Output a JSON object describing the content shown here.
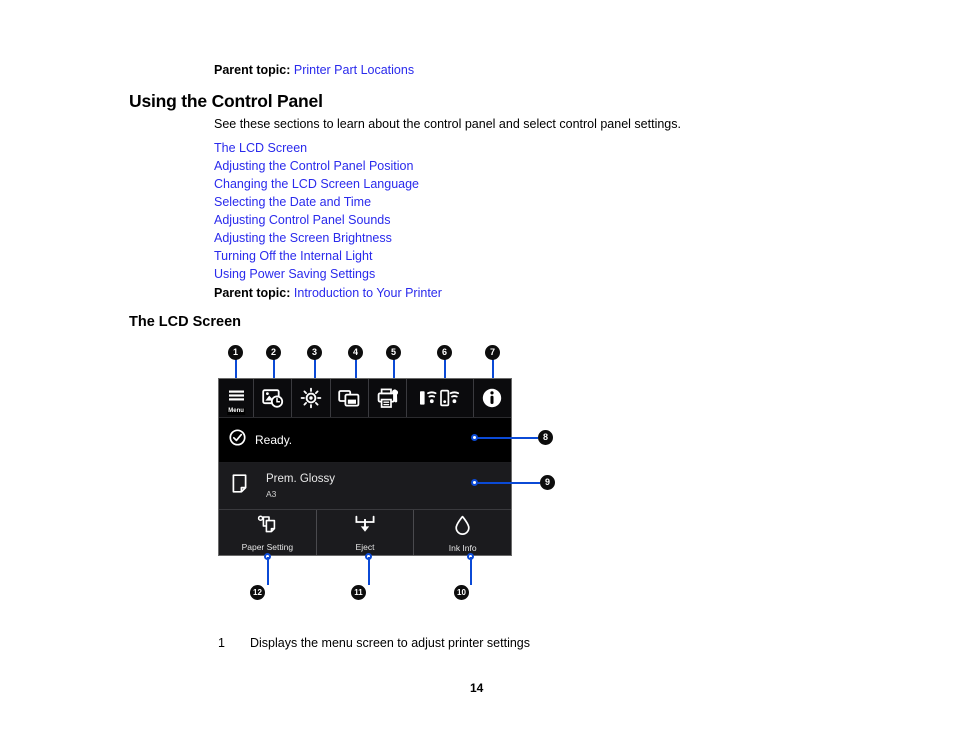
{
  "document": {
    "page_number": "14"
  },
  "top_parent_topic": {
    "label": "Parent topic:",
    "link": "Printer Part Locations"
  },
  "section": {
    "heading": "Using the Control Panel",
    "intro": "See these sections to learn about the control panel and select control panel settings.",
    "links": [
      "The LCD Screen",
      "Adjusting the Control Panel Position",
      "Changing the LCD Screen Language",
      "Selecting the Date and Time",
      "Adjusting Control Panel Sounds",
      "Adjusting the Screen Brightness",
      "Turning Off the Internal Light",
      "Using Power Saving Settings"
    ],
    "parent_topic": {
      "label": "Parent topic:",
      "link": "Introduction to Your Printer"
    }
  },
  "subsection": {
    "heading": "The LCD Screen"
  },
  "lcd": {
    "toolbar": [
      {
        "id": 1,
        "icon": "menu-icon",
        "label": "Menu"
      },
      {
        "id": 2,
        "icon": "print-history-icon",
        "label": ""
      },
      {
        "id": 3,
        "icon": "internal-light-icon",
        "label": ""
      },
      {
        "id": 4,
        "icon": "job-queue-icon",
        "label": ""
      },
      {
        "id": 5,
        "icon": "printer-maintenance-icon",
        "label": ""
      },
      {
        "id": 6,
        "icon": "network-status-icon",
        "label": ""
      },
      {
        "id": 7,
        "icon": "information-icon",
        "label": ""
      }
    ],
    "status": {
      "icon": "check-circle-icon",
      "text": "Ready."
    },
    "paper": {
      "icon": "paper-sheet-icon",
      "type": "Prem. Glossy",
      "size": "A3"
    },
    "buttons": [
      {
        "icon": "paper-setting-icon",
        "label": "Paper Setting"
      },
      {
        "icon": "eject-icon",
        "label": "Eject"
      },
      {
        "icon": "ink-drop-icon",
        "label": "Ink Info"
      }
    ],
    "callouts": [
      "1",
      "2",
      "3",
      "4",
      "5",
      "6",
      "7",
      "8",
      "9",
      "10",
      "11",
      "12"
    ]
  },
  "legend": {
    "items": [
      {
        "num": "1",
        "text": "Displays the menu screen to adjust printer settings"
      }
    ]
  },
  "colors": {
    "link": "#2a2aec",
    "lead_line": "#0b4ad6",
    "callout_bg": "#0d0d0d",
    "lcd_bg": "#000000",
    "lcd_row_bg": "#1b1b1e"
  }
}
